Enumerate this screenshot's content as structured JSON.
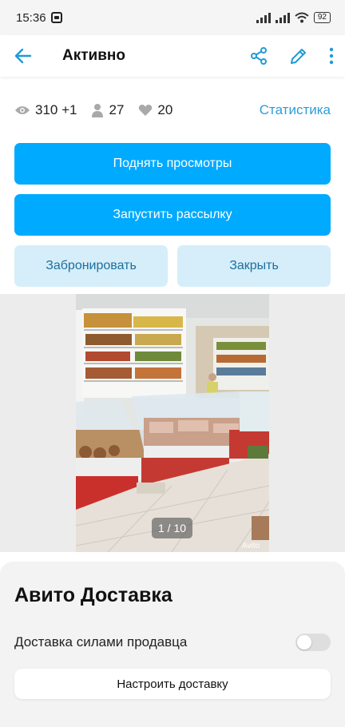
{
  "status_bar": {
    "time": "15:36",
    "battery": "92"
  },
  "header": {
    "title": "Активно"
  },
  "stats": {
    "views": "310 +1",
    "contacts": "27",
    "favorites": "20",
    "statistics_link": "Статистика"
  },
  "actions": {
    "raise_views": "Поднять просмотры",
    "start_mailing": "Запустить рассылку",
    "reserve": "Забронировать",
    "close": "Закрыть"
  },
  "gallery": {
    "counter": "1 / 10",
    "watermark": "Avito"
  },
  "delivery": {
    "title": "Авито Доставка",
    "seller_delivery_label": "Доставка силами продавца",
    "seller_delivery_enabled": false,
    "configure_button": "Настроить доставку"
  },
  "colors": {
    "accent": "#00aaff",
    "link": "#2f9cd6",
    "secondary_button_bg": "#d5eef9",
    "secondary_button_text": "#1d6fa0"
  },
  "icons": [
    "back-arrow-icon",
    "share-icon",
    "edit-pencil-icon",
    "more-vertical-icon",
    "eye-icon",
    "person-icon",
    "heart-icon"
  ]
}
